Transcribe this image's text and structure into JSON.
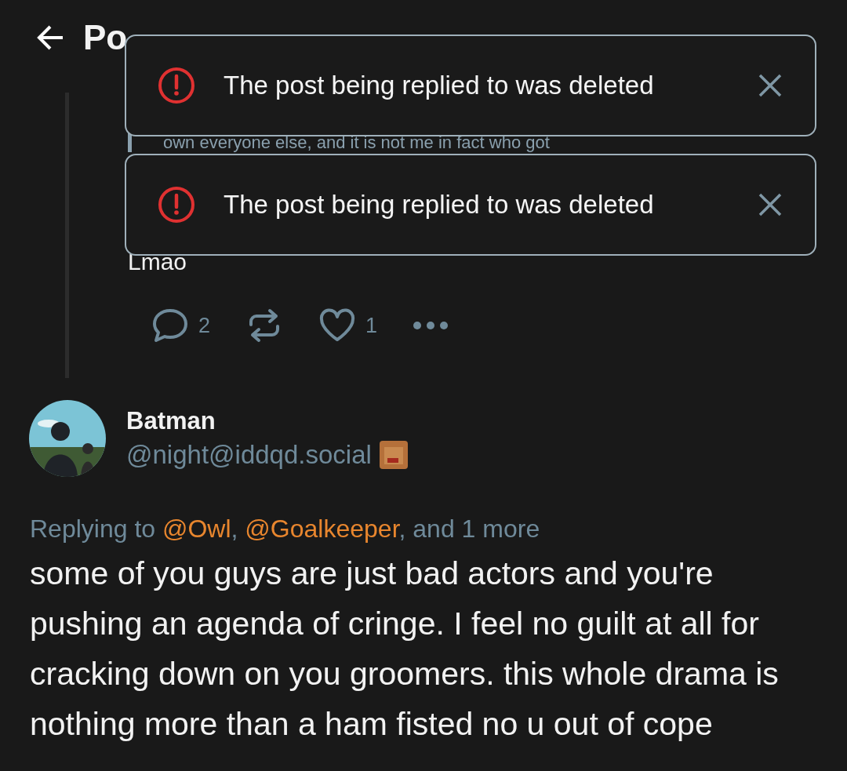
{
  "header": {
    "title": "Po"
  },
  "toasts": [
    {
      "message": "The post being replied to was deleted"
    },
    {
      "message": "The post being replied to was deleted"
    }
  ],
  "parent_post": {
    "quote_line": "own everyone else, and it is not me in fact who got",
    "trailing_text": "Lmao",
    "actions": {
      "replies": "2",
      "likes": "1"
    }
  },
  "post": {
    "display_name": "Batman",
    "handle": "@night@iddqd.social",
    "replying": {
      "prefix": "Replying to ",
      "mentions": [
        "@Owl",
        "@Goalkeeper"
      ],
      "separator": ", ",
      "suffix": ", and 1 more"
    },
    "body": "some of you guys are just bad actors and you're pushing an agenda of cringe. I feel no guilt at all for cracking down on you groomers. this whole drama is nothing more than a ham fisted no u out of cope"
  }
}
